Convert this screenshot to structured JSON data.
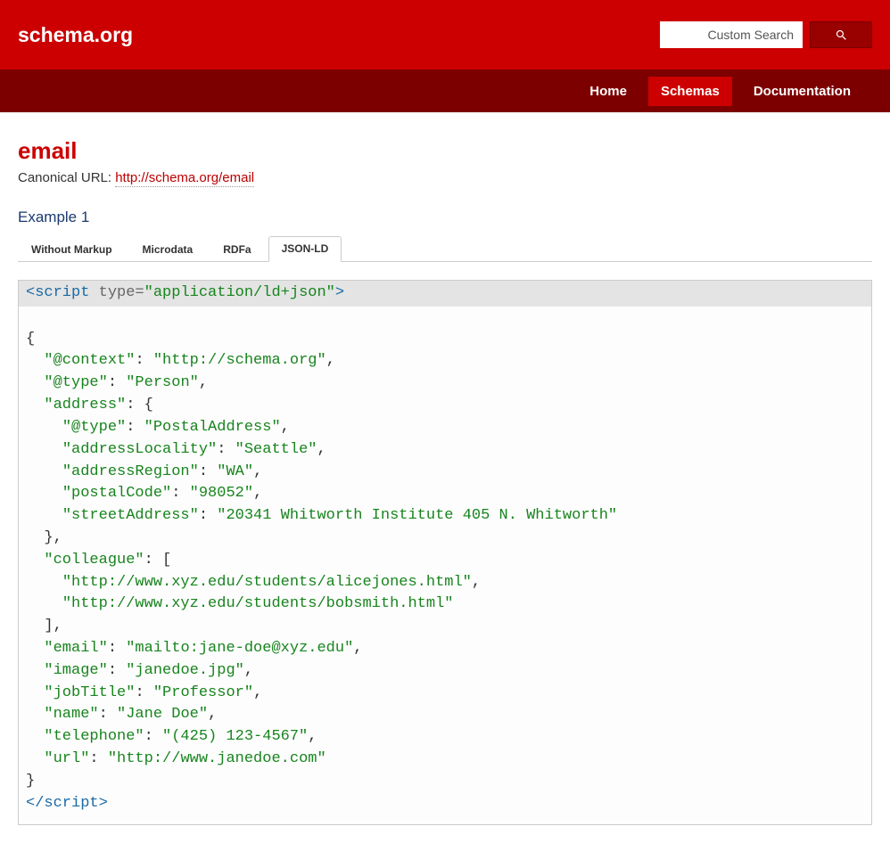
{
  "header": {
    "logo": "schema.org",
    "search_placeholder": "Custom Search"
  },
  "nav": {
    "items": [
      "Home",
      "Schemas",
      "Documentation"
    ],
    "active_index": 1
  },
  "page": {
    "title": "email",
    "canonical_label": "Canonical URL: ",
    "canonical_url": "http://schema.org/email",
    "example_heading": "Example 1"
  },
  "tabs": {
    "items": [
      "Without Markup",
      "Microdata",
      "RDFa",
      "JSON-LD"
    ],
    "active_index": 3
  },
  "code": {
    "open_tag": "<script type=\"application/ld+json\">",
    "close_tag": "</script>",
    "json_body": {
      "@context": "http://schema.org",
      "@type": "Person",
      "address": {
        "@type": "PostalAddress",
        "addressLocality": "Seattle",
        "addressRegion": "WA",
        "postalCode": "98052",
        "streetAddress": "20341 Whitworth Institute 405 N. Whitworth"
      },
      "colleague": [
        "http://www.xyz.edu/students/alicejones.html",
        "http://www.xyz.edu/students/bobsmith.html"
      ],
      "email": "mailto:jane-doe@xyz.edu",
      "image": "janedoe.jpg",
      "jobTitle": "Professor",
      "name": "Jane Doe",
      "telephone": "(425) 123-4567",
      "url": "http://www.janedoe.com"
    }
  }
}
